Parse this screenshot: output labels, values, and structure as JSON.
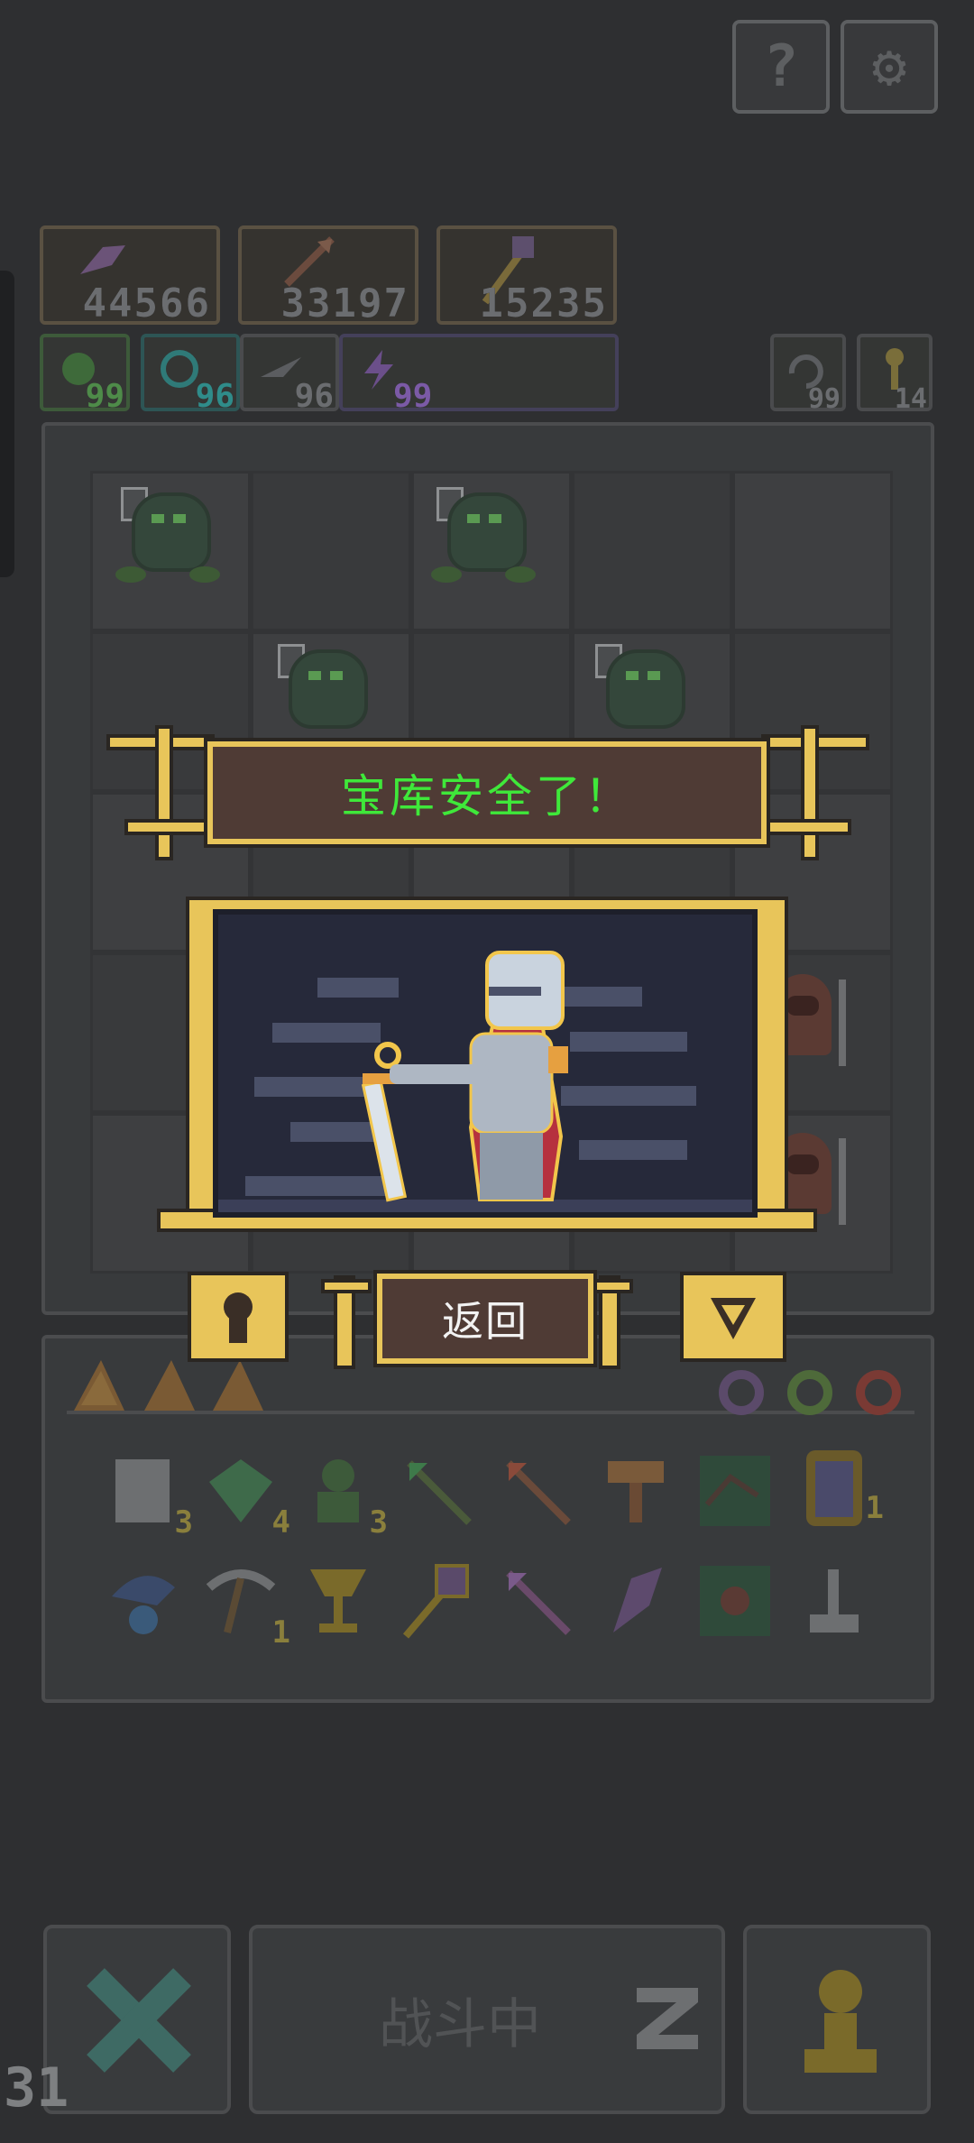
{
  "resources": [
    {
      "icon": "feather-icon",
      "value": "44566"
    },
    {
      "icon": "arrow-icon",
      "value": "33197"
    },
    {
      "icon": "staff-icon",
      "value": "15235"
    }
  ],
  "gems": [
    {
      "icon": "green-orb-icon",
      "value": "99",
      "color": "#4e8b49"
    },
    {
      "icon": "teal-swirl-icon",
      "value": "96",
      "color": "#2f8c8a"
    },
    {
      "icon": "grey-wing-icon",
      "value": "96",
      "color": "#6b6d70"
    },
    {
      "icon": "purple-bolt-icon",
      "value": "99",
      "color": "#7b5aa6"
    }
  ],
  "right_counters": [
    {
      "icon": "refresh-icon",
      "value": "99"
    },
    {
      "icon": "key-icon",
      "value": "14"
    }
  ],
  "modal": {
    "title": "宝库安全了！",
    "back_label": "返回"
  },
  "inventory_counts": {
    "scroll": "3",
    "green_gem": "4",
    "green_figure": "3",
    "potion": "1",
    "pickaxe": "1"
  },
  "bottom": {
    "battle_label": "战斗中",
    "corner_number": "31"
  },
  "colors": {
    "gold": "#e8c55a",
    "banner_text": "#3fe83a",
    "panel_brown": "#4f3b35"
  }
}
